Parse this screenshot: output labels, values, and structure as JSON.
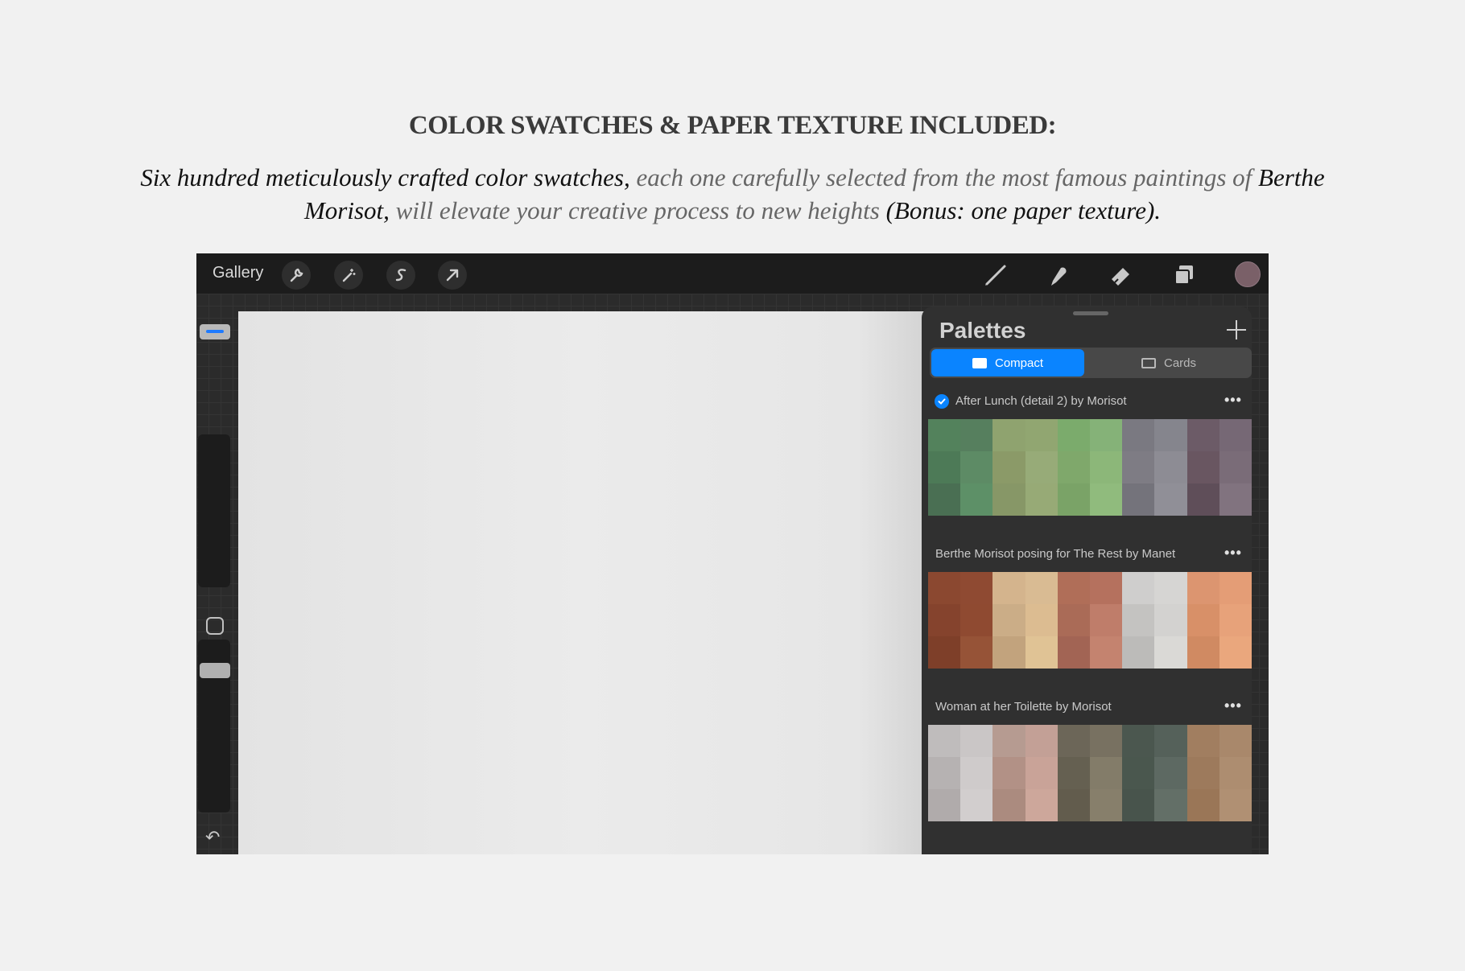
{
  "header": {
    "title": "COLOR SWATCHES & PAPER TEXTURE INCLUDED:",
    "sub_1": "Six hundred meticulously crafted color swatches,",
    "sub_2": " each one carefully selected from the most famous paintings of ",
    "sub_3": "Berthe Morisot,",
    "sub_4": " will elevate your creative process to new heights ",
    "sub_5": "(Bonus: one paper texture)."
  },
  "topbar": {
    "gallery_label": "Gallery",
    "left_icons": [
      "wrench-icon",
      "magic-wand-icon",
      "selection-s-icon",
      "arrow-transform-icon"
    ],
    "right_icons": [
      "brush-icon",
      "smudge-icon",
      "eraser-icon",
      "layers-icon"
    ],
    "current_color": "#7a6068"
  },
  "panel": {
    "title": "Palettes",
    "tabs": {
      "compact": "Compact",
      "cards": "Cards"
    },
    "more_label": "•••",
    "palettes": [
      {
        "name": "After Lunch (detail 2) by Morisot",
        "default": true,
        "colors": [
          [
            "#53825c",
            "#567f5e",
            "#8fa36f",
            "#91a671",
            "#7bab6c",
            "#85b278",
            "#7a7981",
            "#85858d",
            "#6c5b67",
            "#766875"
          ],
          [
            "#4d7a57",
            "#5d8b65",
            "#8b9a68",
            "#97ab78",
            "#7fa86b",
            "#8cb779",
            "#7e7c84",
            "#8d8c94",
            "#695661",
            "#7a6c78"
          ],
          [
            "#4a6f53",
            "#5d9067",
            "#879767",
            "#97aa76",
            "#7aa367",
            "#90bb7d",
            "#74737b",
            "#908f97",
            "#5f4e59",
            "#81737f"
          ]
        ]
      },
      {
        "name": "Berthe Morisot posing for The Rest by Manet",
        "default": false,
        "colors": [
          [
            "#8b4830",
            "#8f4a32",
            "#d4b48d",
            "#d9bb93",
            "#b06e58",
            "#b5715e",
            "#cfcecd",
            "#d6d5d3",
            "#dc9570",
            "#e49d76"
          ],
          [
            "#85432d",
            "#8f4a31",
            "#cbad87",
            "#dcbc91",
            "#aa6b57",
            "#bf7d6a",
            "#c4c3c1",
            "#d3d2d0",
            "#d89068",
            "#e7a27a"
          ],
          [
            "#7e3f29",
            "#965337",
            "#c2a37d",
            "#e0c395",
            "#a26454",
            "#c4836f",
            "#bcbbb9",
            "#dad9d6",
            "#d08a62",
            "#eaa77d"
          ]
        ]
      },
      {
        "name": "Woman at her Toilette by Morisot",
        "default": false,
        "colors": [
          [
            "#bfbcbc",
            "#cac6c6",
            "#b69b91",
            "#c3a096",
            "#6c6658",
            "#787161",
            "#4b574f",
            "#55615a",
            "#a17e60",
            "#a9886b"
          ],
          [
            "#b6b2b2",
            "#cfcbcb",
            "#b29186",
            "#c9a398",
            "#656051",
            "#837c69",
            "#4a574e",
            "#5d6962",
            "#9d7a5c",
            "#ad8d70"
          ],
          [
            "#b0abab",
            "#d2cece",
            "#ab8b7f",
            "#cda79b",
            "#625c4d",
            "#877f6b",
            "#48544c",
            "#636f67",
            "#9a7657",
            "#b09073"
          ]
        ]
      }
    ]
  }
}
